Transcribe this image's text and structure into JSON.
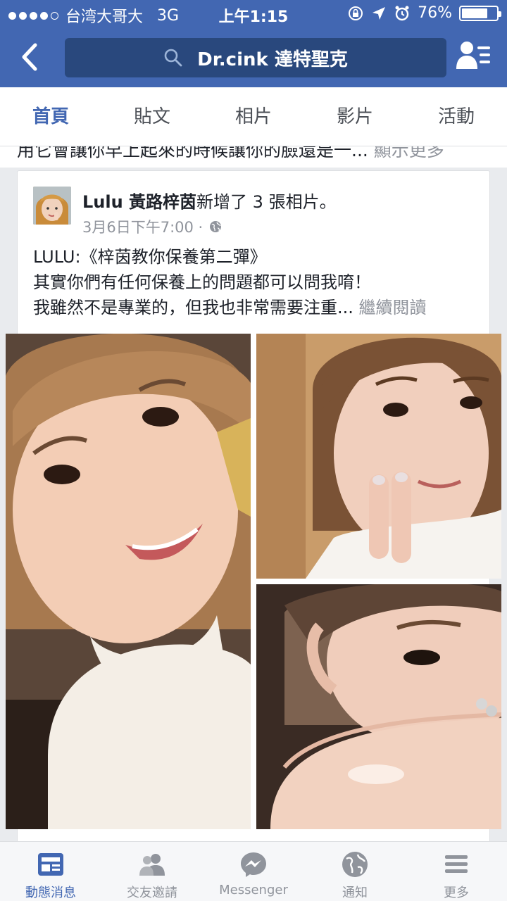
{
  "status_bar": {
    "carrier": "台湾大哥大",
    "network": "3G",
    "time": "上午1:15",
    "battery_text": "76%",
    "battery_level": 0.76
  },
  "nav": {
    "search_text": "Dr.cink 達特聖克"
  },
  "tabs": [
    {
      "label": "首頁",
      "active": true
    },
    {
      "label": "貼文",
      "active": false
    },
    {
      "label": "相片",
      "active": false
    },
    {
      "label": "影片",
      "active": false
    },
    {
      "label": "活動",
      "active": false
    }
  ],
  "prev_post": {
    "text": "用它會讓你早上起來的時候讓你的臉還是一...",
    "more": "顯示更多"
  },
  "post": {
    "author": "Lulu 黃路梓茵",
    "action": "新增了 3 張相片。",
    "time": "3月6日下午7:00 ·",
    "lines": [
      "LULU:《梓茵教你保養第二彈》",
      "其實你們有任何保養上的問題都可以問我唷！",
      "我雖然不是專業的，但我也非常需要注重..."
    ],
    "read_more": "繼續閱讀"
  },
  "bottom_tabs": [
    {
      "label": "動態消息",
      "icon": "news-feed-icon",
      "active": true
    },
    {
      "label": "交友邀請",
      "icon": "friend-requests-icon",
      "active": false
    },
    {
      "label": "Messenger",
      "icon": "messenger-icon",
      "active": false
    },
    {
      "label": "通知",
      "icon": "globe-notifications-icon",
      "active": false
    },
    {
      "label": "更多",
      "icon": "menu-icon",
      "active": false
    }
  ],
  "colors": {
    "brand": "#4267b2",
    "search_bg": "#29487d",
    "muted": "#90949c"
  }
}
